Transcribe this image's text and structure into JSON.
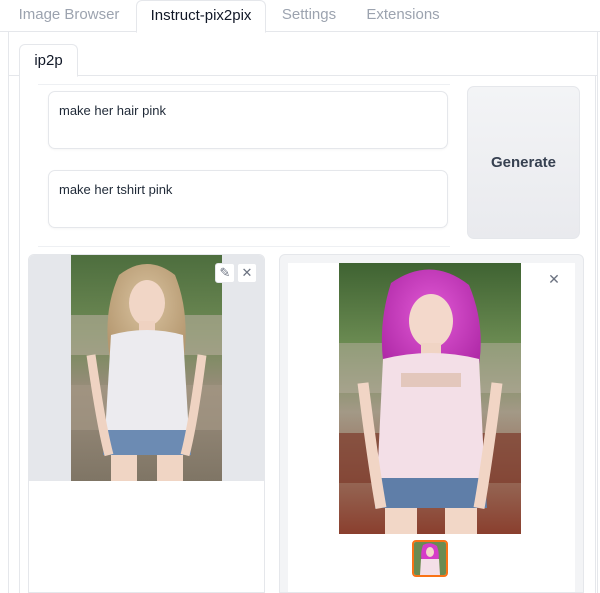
{
  "top_tabs": [
    {
      "label": "Image Browser"
    },
    {
      "label": "Instruct-pix2pix"
    },
    {
      "label": "Settings"
    },
    {
      "label": "Extensions"
    }
  ],
  "sub_tab": {
    "label": "ip2p"
  },
  "prompts": {
    "instruction_1": "make her hair pink",
    "instruction_2": "make her tshirt pink"
  },
  "generate": {
    "label": "Generate"
  },
  "input_image": {
    "edit_icon": "pencil-icon",
    "clear_icon": "close-icon"
  },
  "output_image": {
    "close_icon": "close-icon"
  },
  "colors": {
    "accent": "#f97316",
    "hair_pink": "#d63cc8",
    "border": "#e5e7eb"
  }
}
